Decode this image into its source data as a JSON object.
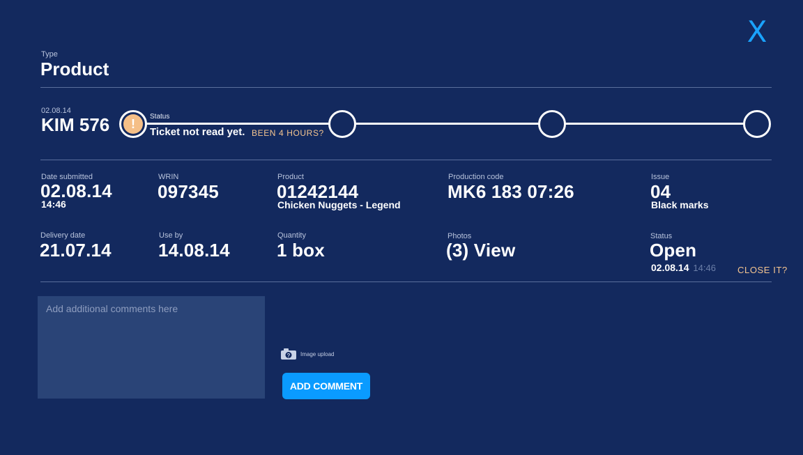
{
  "header": {
    "type_label": "Type",
    "type_value": "Product",
    "close_label": "X"
  },
  "ticket": {
    "date": "02.08.14",
    "id": "KIM 576",
    "status_label": "Status",
    "status_value": "Ticket not read yet.",
    "warning_glyph": "!",
    "elapsed_link": "BEEN 4 HOURS?"
  },
  "details": {
    "date_submitted": {
      "label": "Date submitted",
      "value": "02.08.14",
      "sub": "14:46"
    },
    "wrin": {
      "label": "WRIN",
      "value": "097345"
    },
    "product": {
      "label": "Product",
      "value": "01242144",
      "sub": "Chicken Nuggets - Legend"
    },
    "production_code": {
      "label": "Production code",
      "value": "MK6 183 07:26"
    },
    "issue": {
      "label": "Issue",
      "value": "04",
      "sub": "Black marks"
    },
    "delivery_date": {
      "label": "Delivery date",
      "value": "21.07.14"
    },
    "use_by": {
      "label": "Use by",
      "value": "14.08.14"
    },
    "quantity": {
      "label": "Quantity",
      "value": "1 box"
    },
    "photos": {
      "label": "Photos",
      "value": "(3) View"
    },
    "status": {
      "label": "Status",
      "value": "Open",
      "date": "02.08.14",
      "time": "14:46",
      "close_link": "CLOSE IT?"
    }
  },
  "comment": {
    "placeholder": "Add additional comments here",
    "upload_label": "Image upload",
    "submit_label": "ADD COMMENT"
  },
  "colors": {
    "background": "#13295e",
    "accent": "#0a9bff",
    "warning": "#f5bf87"
  }
}
